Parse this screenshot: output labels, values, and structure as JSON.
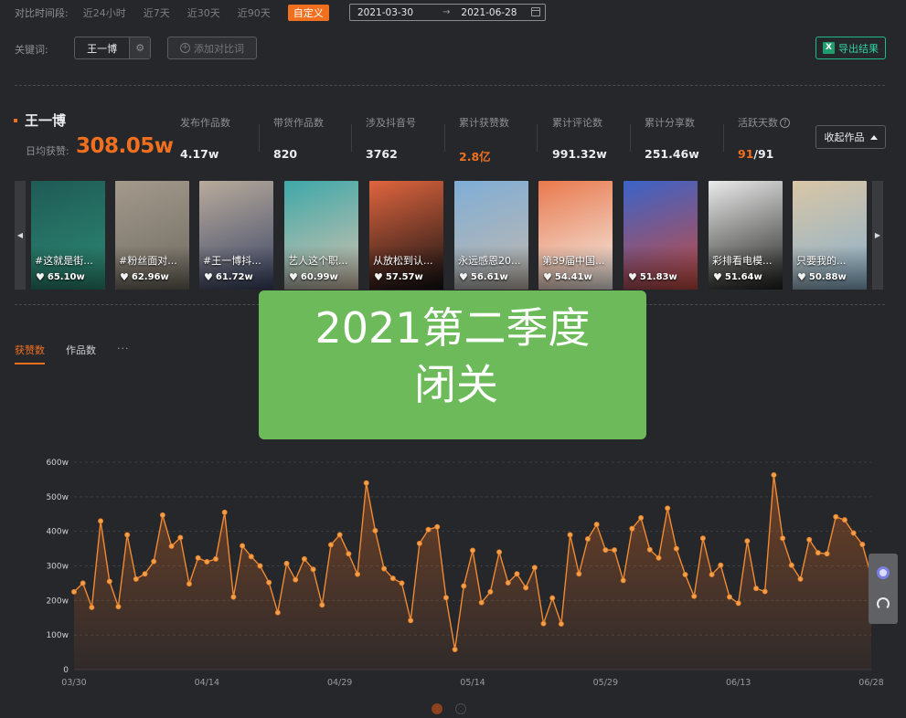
{
  "filter": {
    "period_label": "对比时间段:",
    "options": [
      "近24小时",
      "近7天",
      "近30天",
      "近90天"
    ],
    "custom_label": "自定义",
    "date_start": "2021-03-30",
    "date_end": "2021-06-28"
  },
  "keyword": {
    "label": "关键词:",
    "tag": "王一博",
    "add_label": "添加对比词",
    "export_label": "导出结果"
  },
  "summary": {
    "name": "王一博",
    "avg_label": "日均获赞:",
    "avg_value": "308.05w",
    "stats": [
      {
        "label": "发布作品数",
        "value": "4.17w"
      },
      {
        "label": "带货作品数",
        "value": "820"
      },
      {
        "label": "涉及抖音号",
        "value": "3762"
      },
      {
        "label": "累计获赞数",
        "value": "2.8亿"
      },
      {
        "label": "累计评论数",
        "value": "991.32w"
      },
      {
        "label": "累计分享数",
        "value": "251.46w"
      },
      {
        "label": "活跃天数",
        "value": "91",
        "total": "/91"
      }
    ],
    "collapse_label": "收起作品"
  },
  "works": [
    {
      "caption": "#这就是街...",
      "likes": "65.10w",
      "colors": [
        "#1f5b56",
        "#2d8a74"
      ]
    },
    {
      "caption": "#粉丝面对...",
      "likes": "62.96w",
      "colors": [
        "#a39a8c",
        "#6f6a60"
      ]
    },
    {
      "caption": "#王一博抖...",
      "likes": "61.72w",
      "colors": [
        "#b8ab9c",
        "#3b4566"
      ]
    },
    {
      "caption": "艺人这个职...",
      "likes": "60.99w",
      "colors": [
        "#3ea8a8",
        "#d7c3b0"
      ]
    },
    {
      "caption": "从放松到认...",
      "likes": "57.57w",
      "colors": [
        "#e0653e",
        "#121214"
      ]
    },
    {
      "caption": "永远感恩20...",
      "likes": "56.61w",
      "colors": [
        "#7faed6",
        "#c3b8ad"
      ]
    },
    {
      "caption": "第39届中国...",
      "likes": "54.41w",
      "colors": [
        "#e9794d",
        "#f4f1ec"
      ]
    },
    {
      "caption": "",
      "likes": "51.83w",
      "colors": [
        "#3b63c9",
        "#c84b3f"
      ]
    },
    {
      "caption": "彩排看电模...",
      "likes": "51.64w",
      "colors": [
        "#eaeaea",
        "#20201f"
      ]
    },
    {
      "caption": "只要我的...",
      "likes": "50.88w",
      "colors": [
        "#d9c6a6",
        "#8ab0cc"
      ]
    }
  ],
  "tabs": [
    "获赞数",
    "作品数"
  ],
  "tabs_more": "···",
  "banner": {
    "line1": "2021第二季度",
    "line2": "闭关"
  },
  "colors": {
    "accent": "#f0701f",
    "export": "#2fd1a0",
    "banner": "#6cba5a"
  },
  "chart_data": {
    "type": "line",
    "ylim": [
      0,
      600
    ],
    "ytick_labels": [
      "0",
      "100w",
      "200w",
      "300w",
      "400w",
      "500w",
      "600w"
    ],
    "xtick_labels": [
      "03/30",
      "04/14",
      "04/29",
      "05/14",
      "05/29",
      "06/13",
      "06/28"
    ],
    "x": [
      "03/30",
      "03/31",
      "04/01",
      "04/02",
      "04/03",
      "04/04",
      "04/05",
      "04/06",
      "04/07",
      "04/08",
      "04/09",
      "04/10",
      "04/11",
      "04/12",
      "04/13",
      "04/14",
      "04/15",
      "04/16",
      "04/17",
      "04/18",
      "04/19",
      "04/20",
      "04/21",
      "04/22",
      "04/23",
      "04/24",
      "04/25",
      "04/26",
      "04/27",
      "04/28",
      "04/29",
      "04/30",
      "05/01",
      "05/02",
      "05/03",
      "05/04",
      "05/05",
      "05/06",
      "05/07",
      "05/08",
      "05/09",
      "05/10",
      "05/11",
      "05/12",
      "05/13",
      "05/14",
      "05/15",
      "05/16",
      "05/17",
      "05/18",
      "05/19",
      "05/20",
      "05/21",
      "05/22",
      "05/23",
      "05/24",
      "05/25",
      "05/26",
      "05/27",
      "05/28",
      "05/29",
      "05/30",
      "05/31",
      "06/01",
      "06/02",
      "06/03",
      "06/04",
      "06/05",
      "06/06",
      "06/07",
      "06/08",
      "06/09",
      "06/10",
      "06/11",
      "06/12",
      "06/13",
      "06/14",
      "06/15",
      "06/16",
      "06/17",
      "06/18",
      "06/19",
      "06/20",
      "06/21",
      "06/22",
      "06/23",
      "06/24",
      "06/25",
      "06/26",
      "06/27",
      "06/28"
    ],
    "series": [
      {
        "values": [
          225,
          250,
          180,
          430,
          255,
          182,
          390,
          262,
          277,
          313,
          447,
          357,
          382,
          248,
          323,
          312,
          320,
          455,
          210,
          358,
          327,
          300,
          252,
          165,
          307,
          260,
          320,
          290,
          187,
          361,
          390,
          335,
          276,
          540,
          402,
          292,
          264,
          250,
          142,
          365,
          405,
          413,
          208,
          58,
          242,
          345,
          194,
          225,
          340,
          251,
          277,
          237,
          295,
          133,
          207,
          132,
          390,
          277,
          378,
          420,
          346,
          346,
          258,
          408,
          439,
          347,
          323,
          467,
          350,
          275,
          212,
          380,
          275,
          302,
          210,
          192,
          372,
          235,
          226,
          563,
          380,
          302,
          262,
          376,
          338,
          335,
          442,
          433,
          395,
          362,
          270
        ]
      }
    ]
  }
}
